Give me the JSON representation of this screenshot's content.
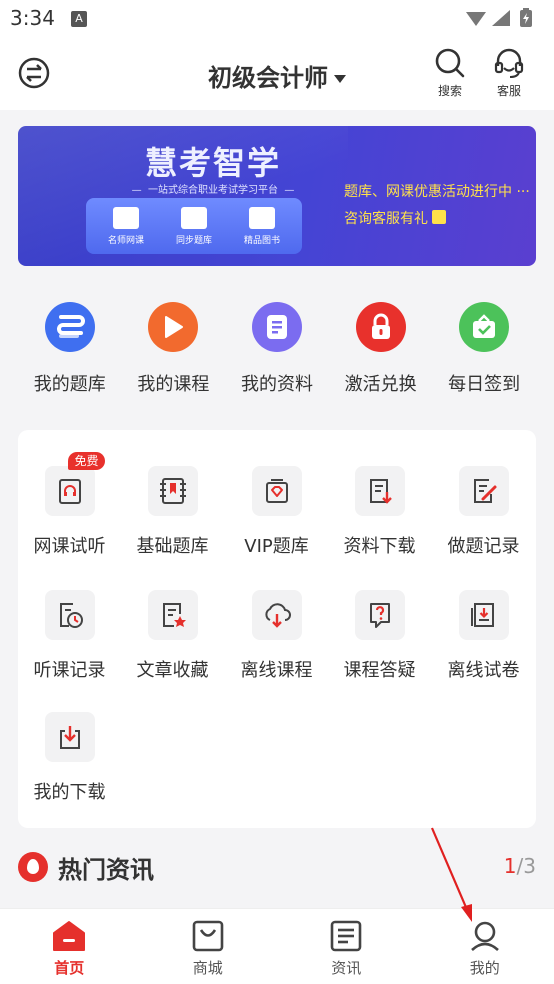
{
  "status_bar": {
    "time": "3:34",
    "notification_letter": "A"
  },
  "header": {
    "title": "初级会计师",
    "search_label": "搜索",
    "service_label": "客服"
  },
  "banner": {
    "brand": "慧考智学",
    "tagline": "一站式综合职业考试学习平台",
    "features": [
      "名师网课",
      "同步题库",
      "精品图书"
    ],
    "promo_line1": "题库、网课优惠活动进行中 ···",
    "promo_line2": "咨询客服有礼"
  },
  "quick_actions": [
    {
      "label": "我的题库",
      "icon": "question-bank-icon",
      "color": "#3f6ff0"
    },
    {
      "label": "我的课程",
      "icon": "play-icon",
      "color": "#f26a2e"
    },
    {
      "label": "我的资料",
      "icon": "document-icon",
      "color": "#7b6cf0"
    },
    {
      "label": "激活兑换",
      "icon": "lock-icon",
      "color": "#e8312c"
    },
    {
      "label": "每日签到",
      "icon": "gift-box-icon",
      "color": "#4cc25a"
    }
  ],
  "tools": [
    {
      "label": "网课试听",
      "icon": "headphone-icon",
      "badge": "免费"
    },
    {
      "label": "基础题库",
      "icon": "book-icon"
    },
    {
      "label": "VIP题库",
      "icon": "vip-book-icon"
    },
    {
      "label": "资料下载",
      "icon": "file-download-icon"
    },
    {
      "label": "做题记录",
      "icon": "edit-record-icon"
    },
    {
      "label": "听课记录",
      "icon": "clock-record-icon"
    },
    {
      "label": "文章收藏",
      "icon": "star-article-icon"
    },
    {
      "label": "离线课程",
      "icon": "cloud-download-icon"
    },
    {
      "label": "课程答疑",
      "icon": "question-bubble-icon"
    },
    {
      "label": "离线试卷",
      "icon": "paper-download-icon"
    },
    {
      "label": "我的下载",
      "icon": "download-icon"
    }
  ],
  "news": {
    "title": "热门资讯",
    "page_current": "1",
    "page_total": "/3"
  },
  "tabs": [
    {
      "label": "首页",
      "icon": "home-icon",
      "active": true
    },
    {
      "label": "商城",
      "icon": "shop-bag-icon",
      "active": false
    },
    {
      "label": "资讯",
      "icon": "news-icon",
      "active": false
    },
    {
      "label": "我的",
      "icon": "user-icon",
      "active": false
    }
  ],
  "colors": {
    "accent": "#e5302c",
    "banner": "#4444d4",
    "promo_text": "#ffe14a"
  }
}
